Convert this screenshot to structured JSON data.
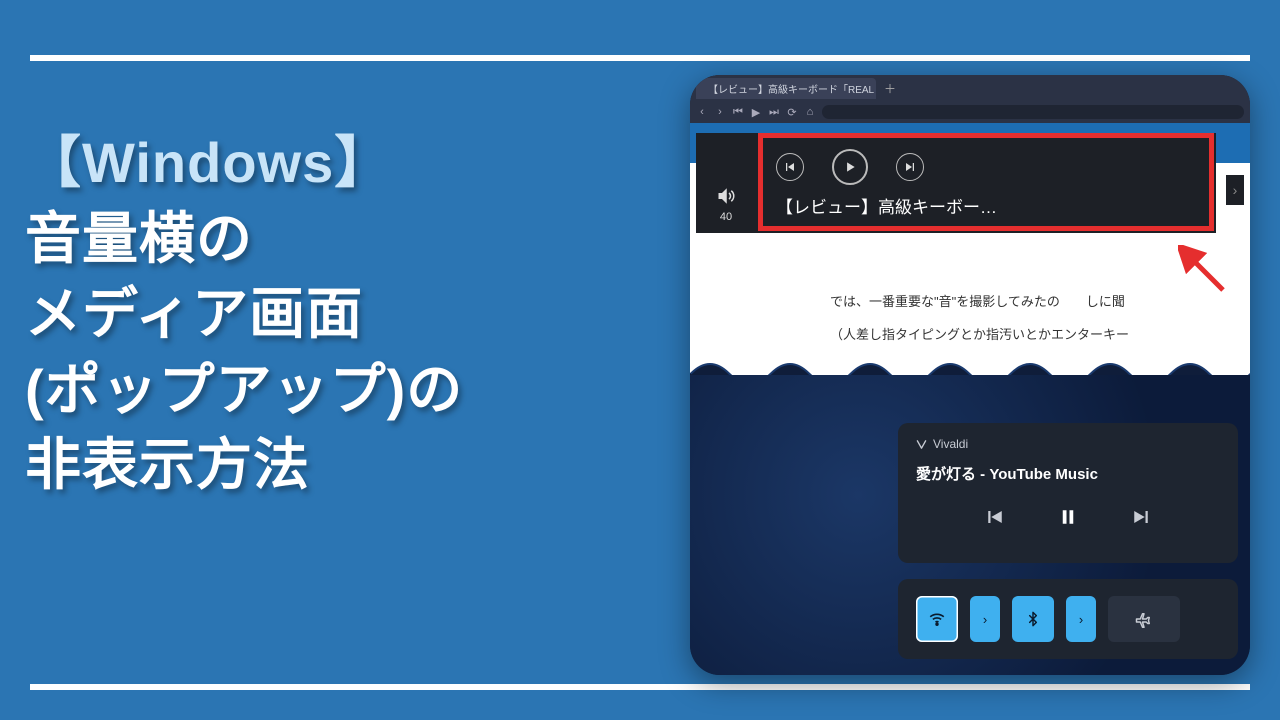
{
  "title": {
    "line1_accent": "【Windows】",
    "line2": "音量横の",
    "line3": "メディア画面",
    "line4": "(ポップアップ)の",
    "line5": "非表示方法"
  },
  "browser": {
    "tab_label": "【レビュー】高級キーボード「REAL",
    "volume_value": "40",
    "media_title": "【レビュー】高級キーボー…",
    "page_text1": "では、一番重要な\"音\"を撮影してみたの　　しに聞",
    "page_text2": "（人差し指タイピングとか指汚いとかエンターキー"
  },
  "media_card": {
    "app_name": "Vivaldi",
    "track": "愛が灯る - YouTube Music"
  }
}
